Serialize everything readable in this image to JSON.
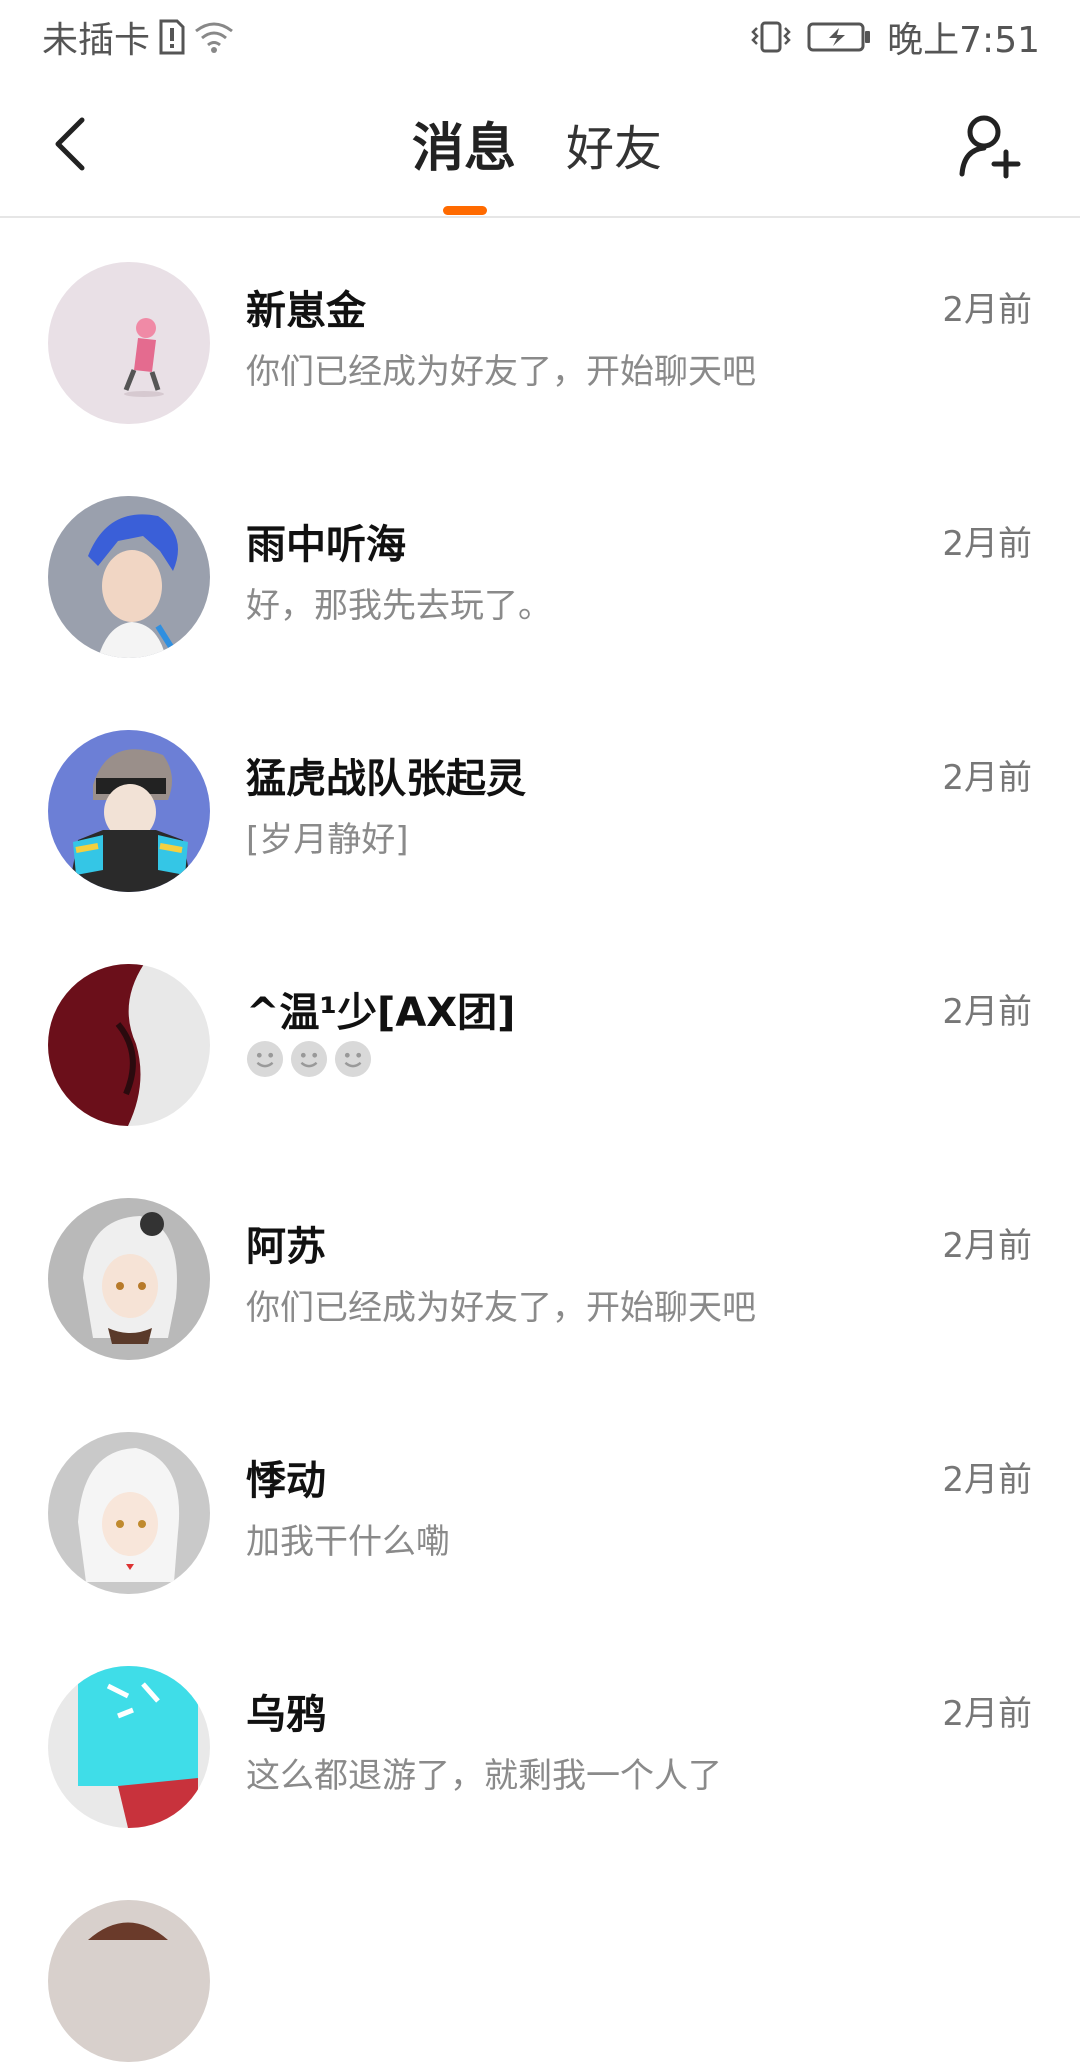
{
  "status_bar": {
    "carrier": "未插卡",
    "time": "晚上7:51"
  },
  "header": {
    "tabs": [
      {
        "label": "消息",
        "active": true
      },
      {
        "label": "好友",
        "active": false
      }
    ],
    "accent_color": "#ff6a00"
  },
  "messages": [
    {
      "name": "新崽金",
      "preview": "你们已经成为好友了，开始聊天吧",
      "time": "2月前",
      "avatar_color": "#e9e0e6"
    },
    {
      "name": "雨中听海",
      "preview": "好，那我先去玩了。",
      "time": "2月前",
      "avatar_color": "#9aa0ad"
    },
    {
      "name": "猛虎战队张起灵",
      "preview": "[岁月静好]",
      "time": "2月前",
      "avatar_color": "#6c7fd6"
    },
    {
      "name": "^温¹少[AX团]",
      "preview": "",
      "preview_icons": [
        "smiley-icon",
        "smiley-icon",
        "smiley-icon"
      ],
      "time": "2月前",
      "avatar_color": "#6b0f1a"
    },
    {
      "name": "阿苏",
      "preview": "你们已经成为好友了，开始聊天吧",
      "time": "2月前",
      "avatar_color": "#b9b9b9"
    },
    {
      "name": "悸动",
      "preview": "加我干什么嘞",
      "time": "2月前",
      "avatar_color": "#c9c9c9"
    },
    {
      "name": "乌鸦",
      "preview": "这么都退游了，就剩我一个人了",
      "time": "2月前",
      "avatar_color": "#3fdde8"
    }
  ]
}
